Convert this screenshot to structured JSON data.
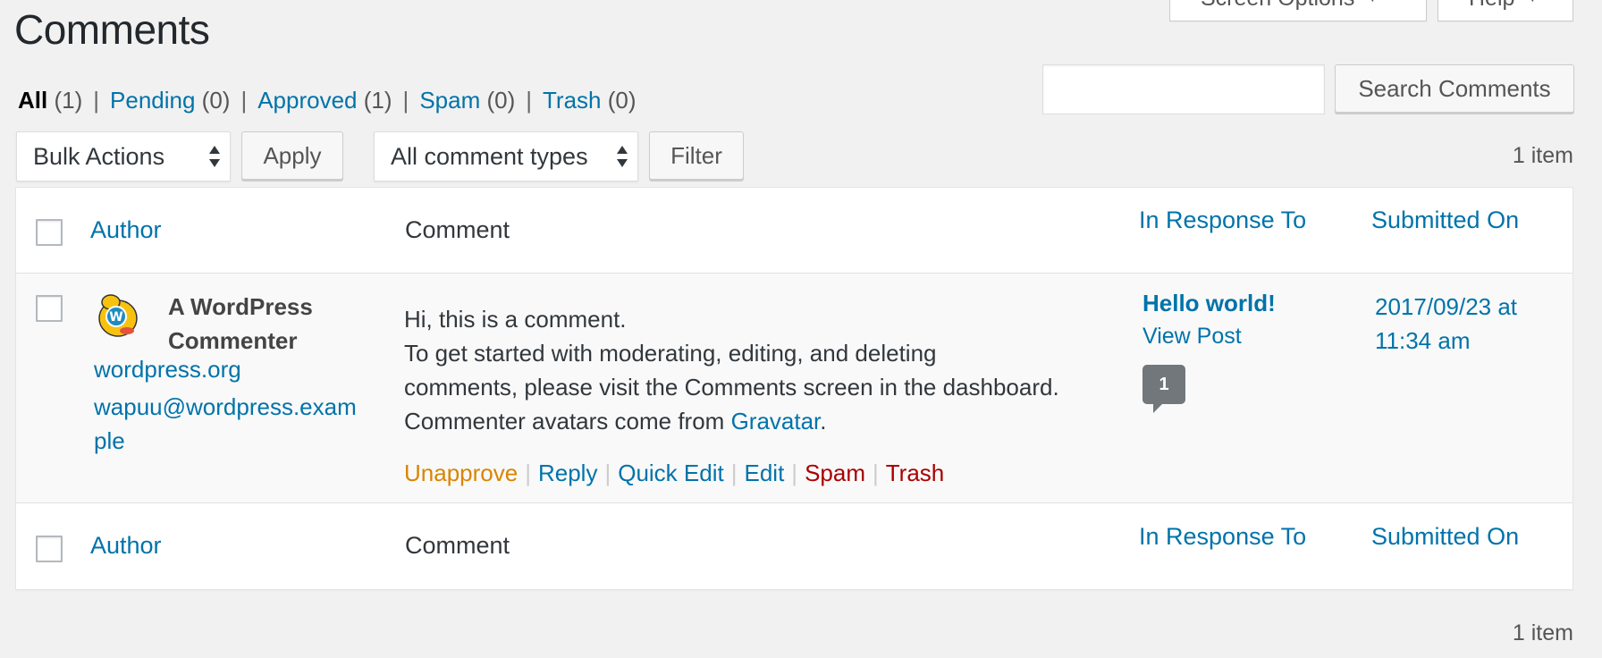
{
  "screen_meta": {
    "screen_options_label": "Screen Options",
    "help_label": "Help"
  },
  "page_title": "Comments",
  "filters": [
    {
      "label": "All",
      "count": "(1)",
      "current": true
    },
    {
      "label": "Pending",
      "count": "(0)",
      "current": false
    },
    {
      "label": "Approved",
      "count": "(1)",
      "current": false
    },
    {
      "label": "Spam",
      "count": "(0)",
      "current": false
    },
    {
      "label": "Trash",
      "count": "(0)",
      "current": false
    }
  ],
  "search": {
    "value": "",
    "button_label": "Search Comments"
  },
  "tablenav": {
    "bulk_actions": "Bulk Actions",
    "apply_label": "Apply",
    "comment_types": "All comment types",
    "filter_label": "Filter",
    "items_count": "1 item"
  },
  "table": {
    "columns": {
      "author": "Author",
      "comment": "Comment",
      "response": "In Response To",
      "submitted": "Submitted On"
    },
    "row": {
      "author_name_line1": "A WordPress",
      "author_name_line2": "Commenter",
      "author_url": "wordpress.org",
      "author_email_line1": "wapuu@wordpress.exam",
      "author_email_line2": "ple",
      "comment_line1": "Hi, this is a comment.",
      "comment_line2": "To get started with moderating, editing, and deleting",
      "comment_line3": "comments, please visit the Comments screen in the dashboard.",
      "comment_line4_prefix": "Commenter avatars come from ",
      "comment_line4_link": "Gravatar",
      "comment_line4_suffix": ".",
      "actions": {
        "unapprove": "Unapprove",
        "reply": "Reply",
        "quick_edit": "Quick Edit",
        "edit": "Edit",
        "spam": "Spam",
        "trash": "Trash"
      },
      "post_title": "Hello world!",
      "view_post": "View Post",
      "comment_count": "1",
      "submitted_line1": "2017/09/23 at",
      "submitted_line2": "11:34 am"
    }
  },
  "bottom_items_count": "1 item",
  "colors": {
    "link": "#0073aa",
    "approve": "#d98500",
    "delete": "#aa0000",
    "background": "#f1f1f1"
  }
}
